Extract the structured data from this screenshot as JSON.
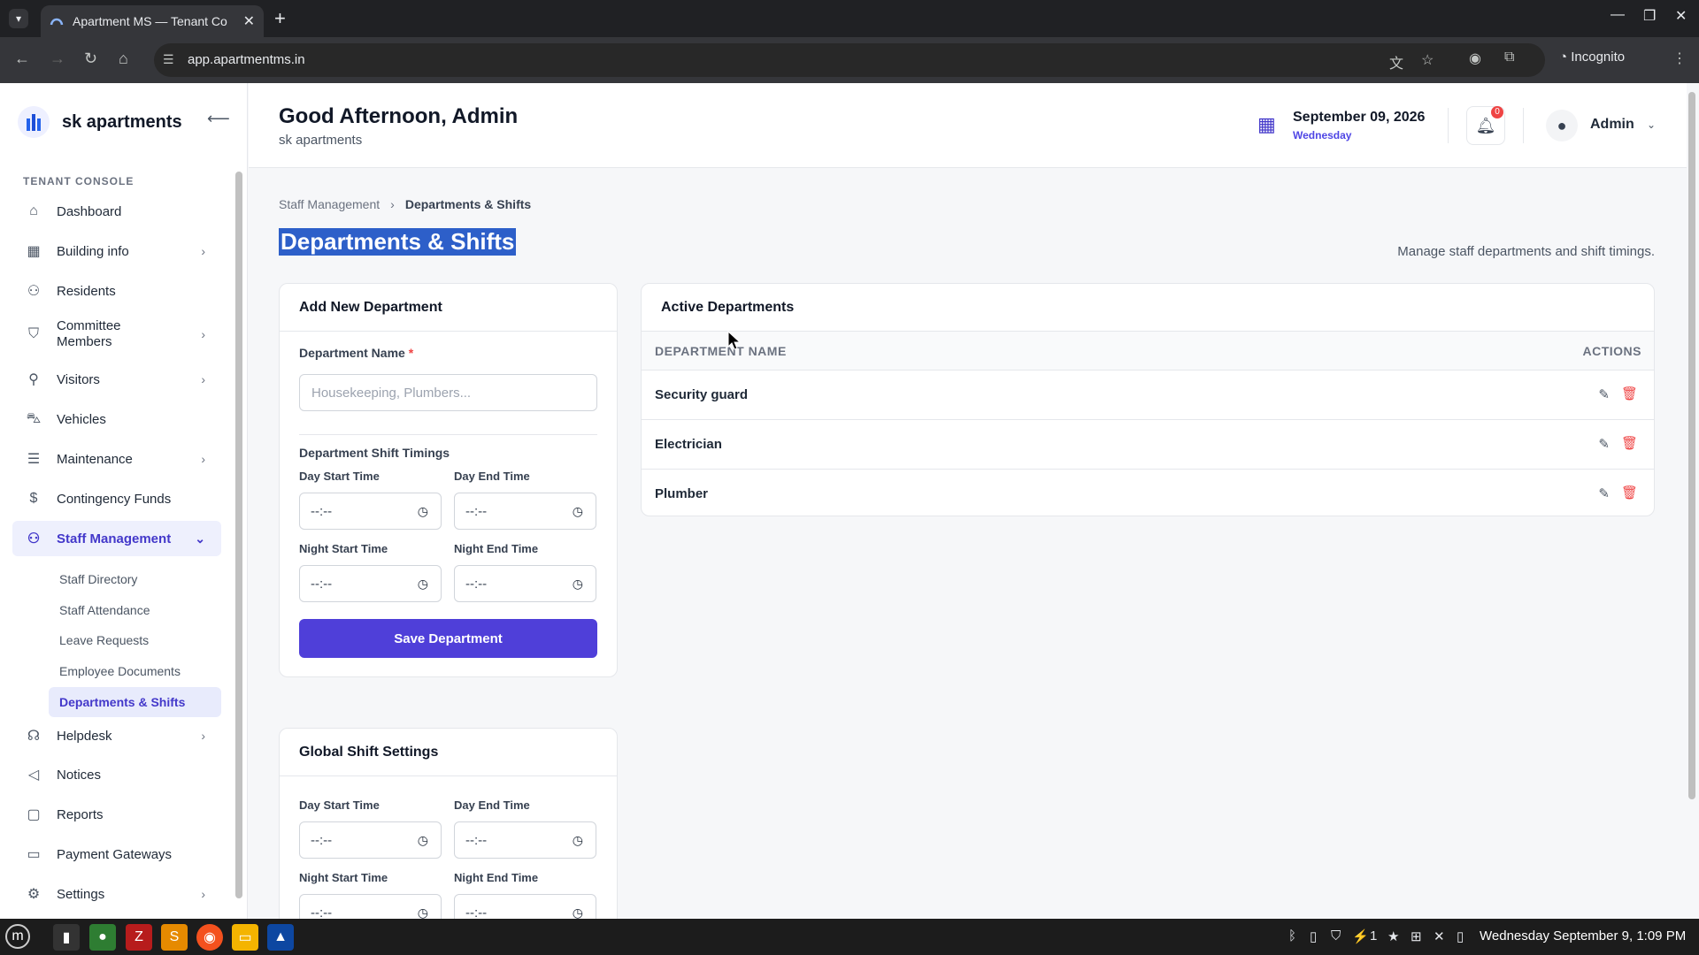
{
  "browser": {
    "tab_title": "Apartment MS — Tenant Co",
    "url": "app.apartmentms.in",
    "incognito_label": "Incognito"
  },
  "sidebar": {
    "brand": "sk apartments",
    "section_label": "TENANT CONSOLE",
    "items": [
      {
        "label": "Dashboard",
        "icon": "home-icon"
      },
      {
        "label": "Building info",
        "icon": "grid-icon"
      },
      {
        "label": "Residents",
        "icon": "users-icon"
      },
      {
        "label": "Committee\nMembers",
        "icon": "shield-icon"
      },
      {
        "label": "Visitors",
        "icon": "user-plus-icon"
      },
      {
        "label": "Vehicles",
        "icon": "car-icon"
      },
      {
        "label": "Maintenance",
        "icon": "server-icon"
      },
      {
        "label": "Contingency Funds",
        "icon": "dollar-icon"
      },
      {
        "label": "Staff Management",
        "icon": "users-icon"
      },
      {
        "label": "Helpdesk",
        "icon": "headset-icon"
      },
      {
        "label": "Notices",
        "icon": "megaphone-icon"
      },
      {
        "label": "Reports",
        "icon": "document-icon"
      },
      {
        "label": "Payment Gateways",
        "icon": "card-icon"
      },
      {
        "label": "Settings",
        "icon": "gear-icon"
      }
    ],
    "sub_items": [
      "Staff Directory",
      "Staff Attendance",
      "Leave Requests",
      "Employee Documents",
      "Departments & Shifts"
    ]
  },
  "header": {
    "greeting": "Good Afternoon, Admin",
    "subtitle": "sk apartments",
    "date": "September 09, 2026",
    "weekday": "Wednesday",
    "notification_count": "0",
    "user": "Admin"
  },
  "page": {
    "breadcrumb_parent": "Staff Management",
    "breadcrumb_current": "Departments & Shifts",
    "title": "Departments & Shifts",
    "description": "Manage staff departments and shift timings."
  },
  "add_department": {
    "title": "Add New Department",
    "name_label": "Department Name",
    "required_mark": "*",
    "name_placeholder": "Housekeeping, Plumbers...",
    "timings_label": "Department Shift Timings",
    "day_start_label": "Day Start Time",
    "day_end_label": "Day End Time",
    "night_start_label": "Night Start Time",
    "night_end_label": "Night End Time",
    "time_placeholder": "--:--",
    "save_label": "Save Department"
  },
  "global_shift": {
    "title": "Global Shift Settings",
    "day_start_label": "Day Start Time",
    "day_end_label": "Day End Time",
    "night_start_label": "Night Start Time",
    "night_end_label": "Night End Time",
    "time_placeholder": "--:--"
  },
  "active_departments": {
    "title": "Active Departments",
    "col_name": "DEPARTMENT NAME",
    "col_actions": "ACTIONS",
    "rows": [
      "Security guard",
      "Electrician",
      "Plumber"
    ]
  },
  "taskbar": {
    "clock": "Wednesday September 9, 1:09 PM",
    "tray_count": "1"
  },
  "colors": {
    "accent": "#4f3fd9",
    "active_nav_bg": "#eef0fd",
    "danger": "#ef4444"
  }
}
